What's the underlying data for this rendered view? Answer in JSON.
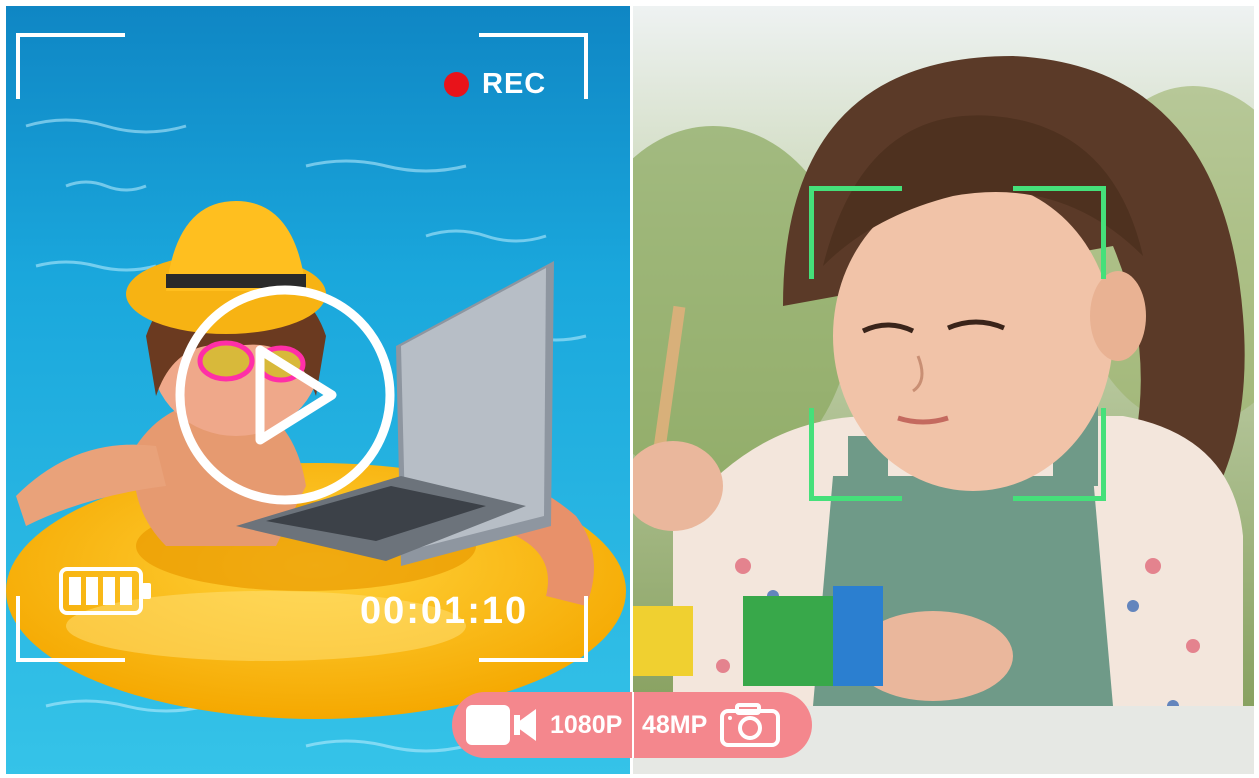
{
  "recording": {
    "indicator_label": "REC",
    "timecode": "00:01:10"
  },
  "specs": {
    "video_resolution": "1080P",
    "photo_resolution": "48MP"
  },
  "icons": {
    "play": "play-icon",
    "battery": "battery-icon",
    "video": "video-camera-icon",
    "photo": "photo-camera-icon"
  },
  "colors": {
    "rec_dot": "#e8131a",
    "face_frame": "#45e07a",
    "spec_badge": "#f4878d",
    "pool_water": "#1aa7dc",
    "float_ring": "#ffc21a"
  }
}
